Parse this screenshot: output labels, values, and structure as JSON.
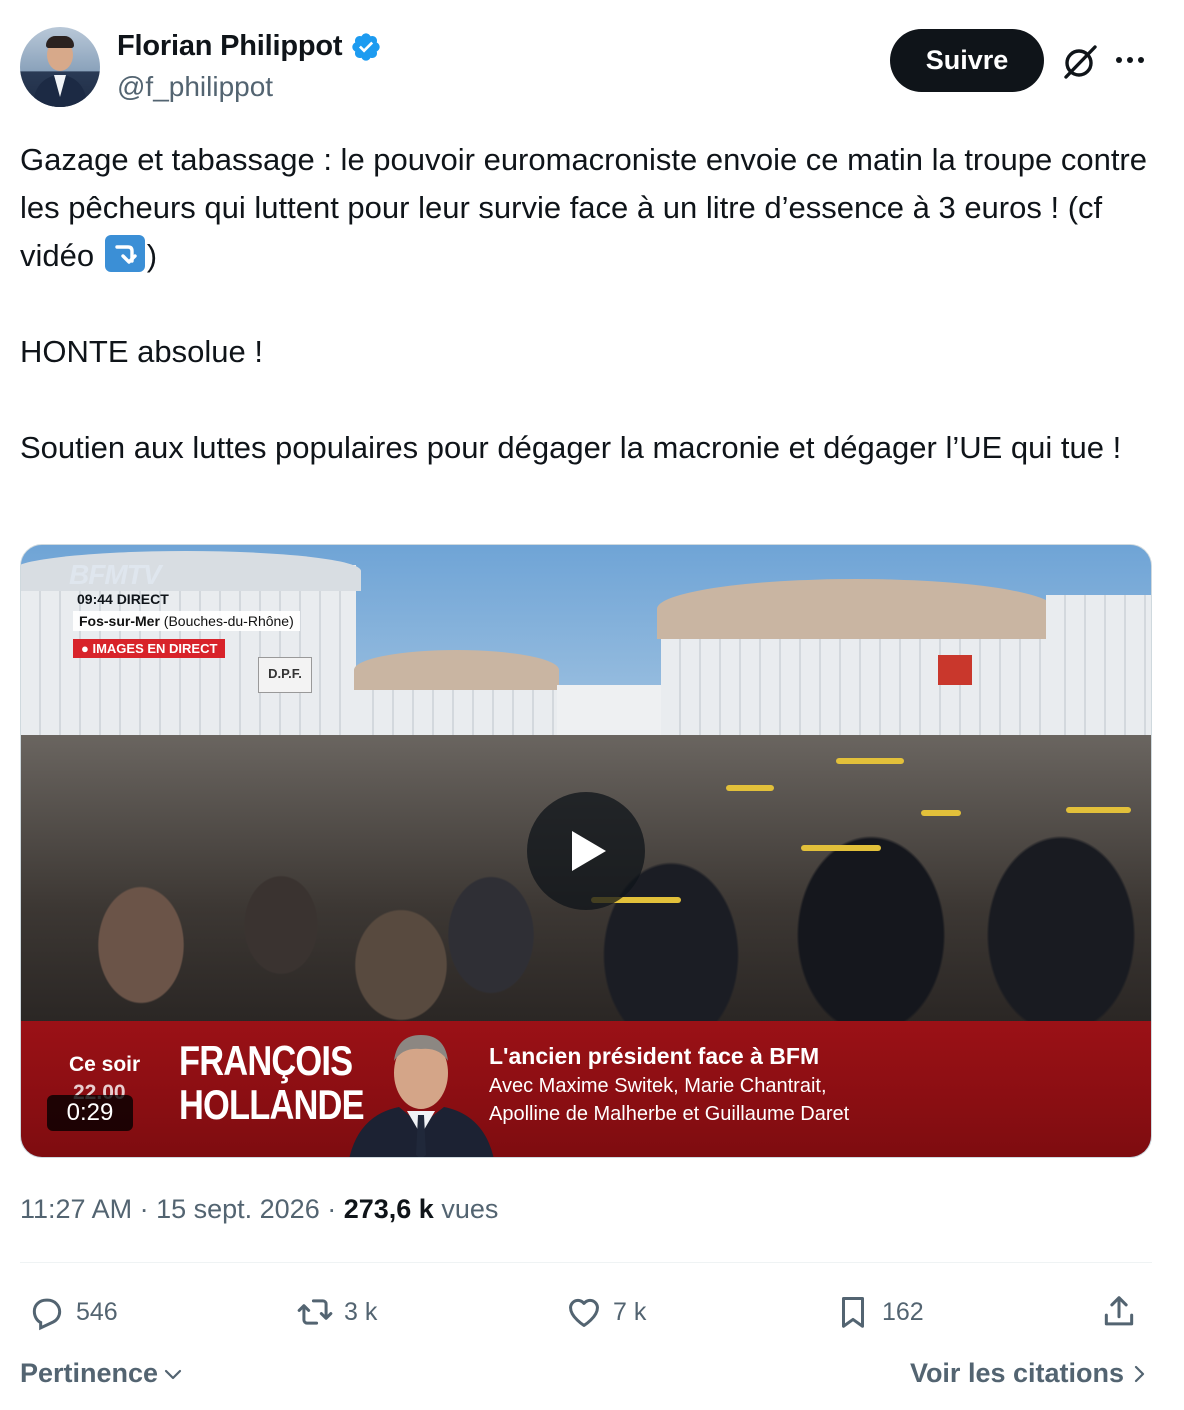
{
  "author": {
    "name": "Florian Philippot",
    "handle": "@f_philippot",
    "verified": true
  },
  "header": {
    "follow_label": "Suivre",
    "icons": [
      "grok-icon",
      "more-icon"
    ]
  },
  "tweet": {
    "paragraph1_part1": "Gazage et tabassage : le pouvoir euromacroniste envoie ce matin la troupe contre les pêcheurs qui luttent pour leur survie face à un litre d’essence à 3 euros ! (cf vidéo ",
    "paragraph1_part2": ")",
    "paragraph2": "HONTE absolue !",
    "paragraph3": "Soutien aux luttes populaires pour dégager la macronie et dégager l’UE qui tue !"
  },
  "video": {
    "duration": "0:29",
    "overlay": {
      "channel": "BFMTV",
      "time_status": "09:44  DIRECT",
      "location": "Fos-sur-Mer",
      "location_detail": "(Bouches-du-Rhône)",
      "live_label": "● IMAGES EN DIRECT",
      "sign": "D.P.F."
    },
    "banner": {
      "ce_soir": "Ce soir",
      "time": "22.00",
      "name_line1": "FRANÇOIS",
      "name_line2": "HOLLANDE",
      "title": "L'ancien président face à BFM",
      "subtitle1": "Avec Maxime Switek, Marie Chantrait,",
      "subtitle2": "Apolline de Malherbe et Guillaume Daret"
    }
  },
  "meta": {
    "time": "11:27 AM",
    "separator": " · ",
    "date": "15 sept. 2026",
    "views_count": "273,6 k",
    "views_label": " vues"
  },
  "actions": {
    "replies": "546",
    "reposts": "3 k",
    "likes": "7 k",
    "bookmarks": "162"
  },
  "footer": {
    "sort_label": "Pertinence",
    "quotes_label": "Voir les citations"
  },
  "colors": {
    "text": "#0f1419",
    "secondary": "#536471",
    "verified": "#1d9bf0",
    "banner_red": "#9b1116"
  }
}
